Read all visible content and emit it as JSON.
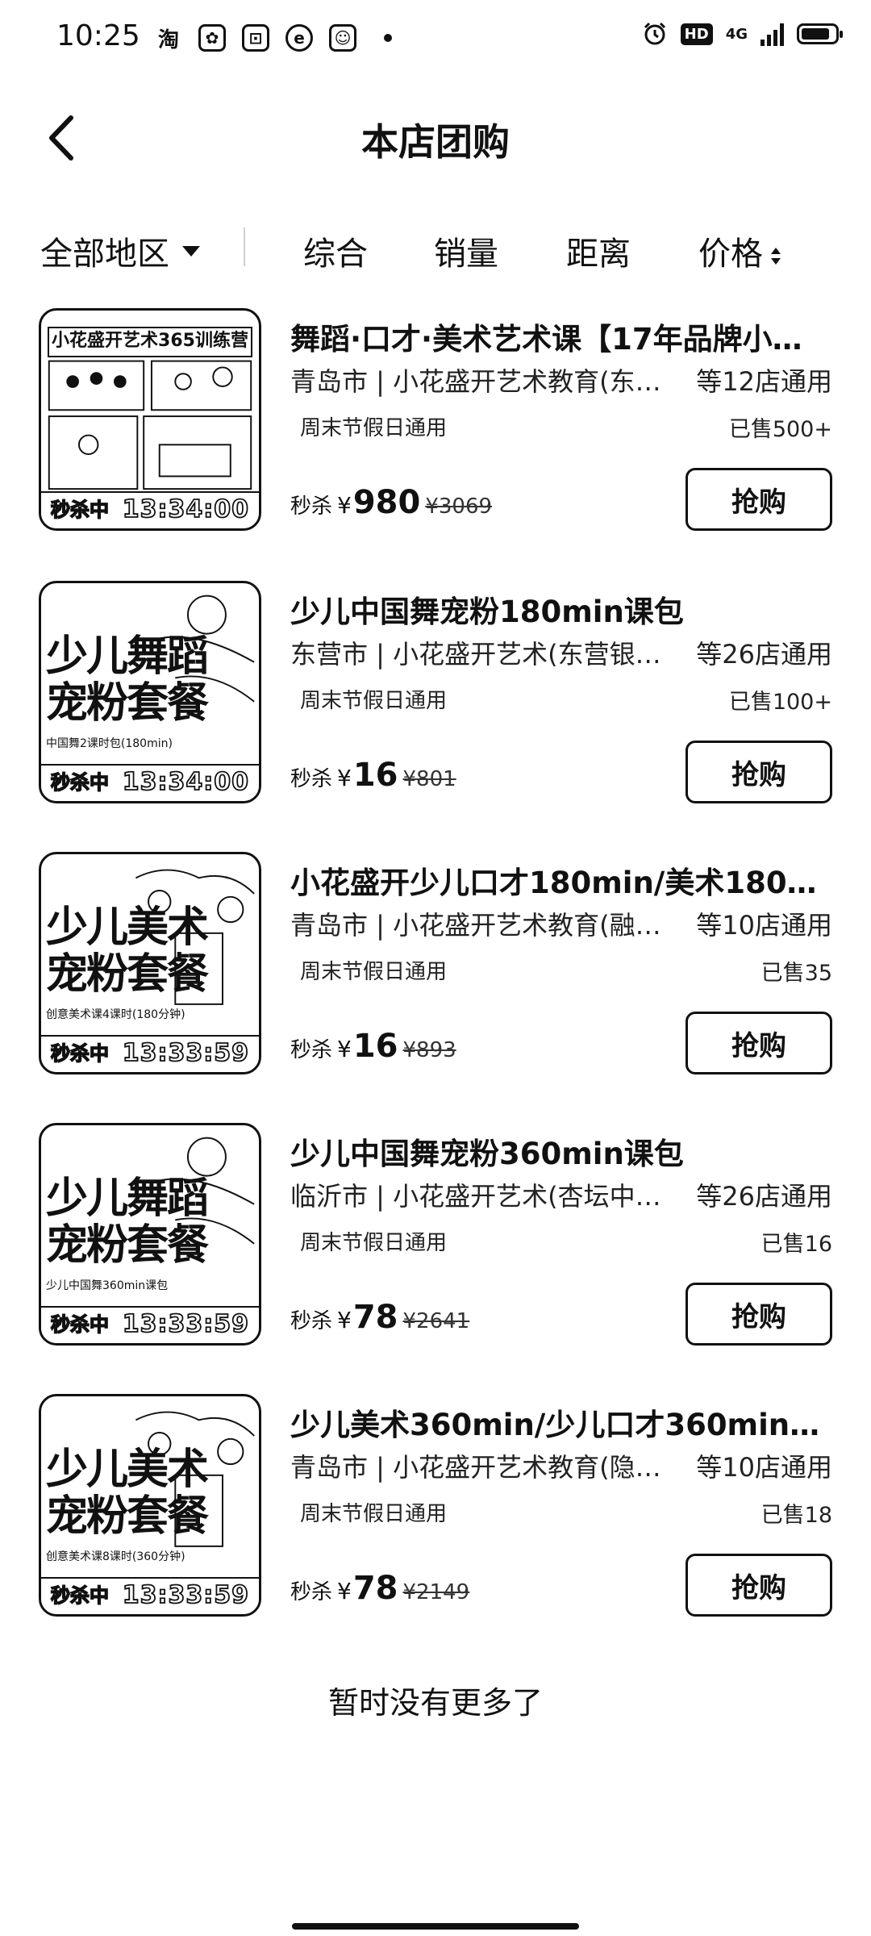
{
  "status_bar": {
    "time": "10:25",
    "left_icons": [
      "taobao-icon",
      "app-icon-1",
      "app-icon-2",
      "app-icon-3",
      "app-icon-4"
    ],
    "hd": "HD",
    "network": "4G"
  },
  "header": {
    "title": "本店团购"
  },
  "filters": {
    "region": "全部地区",
    "sort_overall": "综合",
    "sort_sales": "销量",
    "sort_distance": "距离",
    "sort_price": "价格"
  },
  "products": [
    {
      "title": "舞蹈·口才·美术艺术课【17年品牌小…",
      "location": "青岛市 | 小花盛开艺术教育(东…",
      "stores": "等12店通用",
      "tag": "周末节假日通用",
      "sold": "已售500+",
      "price_label": "秒杀",
      "currency": "¥",
      "price": "980",
      "original_price": "¥3069",
      "thumb_label": "秒杀中",
      "timer": "13:34:00",
      "thumb_banner": "小花盛开艺术365训练营",
      "thumb_headline": "",
      "thumb_caption": "",
      "buy_label": "抢购"
    },
    {
      "title": "少儿中国舞宠粉180min课包",
      "location": "东营市 | 小花盛开艺术(东营银…",
      "stores": "等26店通用",
      "tag": "周末节假日通用",
      "sold": "已售100+",
      "price_label": "秒杀",
      "currency": "¥",
      "price": "16",
      "original_price": "¥801",
      "thumb_label": "秒杀中",
      "timer": "13:34:00",
      "thumb_banner": "",
      "thumb_headline": "少儿舞蹈\n宠粉套餐",
      "thumb_caption": "中国舞2课时包(180min)",
      "buy_label": "抢购"
    },
    {
      "title": "小花盛开少儿口才180min/美术180…",
      "location": "青岛市 | 小花盛开艺术教育(融…",
      "stores": "等10店通用",
      "tag": "周末节假日通用",
      "sold": "已售35",
      "price_label": "秒杀",
      "currency": "¥",
      "price": "16",
      "original_price": "¥893",
      "thumb_label": "秒杀中",
      "timer": "13:33:59",
      "thumb_banner": "",
      "thumb_headline": "少儿美术\n宠粉套餐",
      "thumb_caption": "创意美术课4课时(180分钟)",
      "buy_label": "抢购"
    },
    {
      "title": "少儿中国舞宠粉360min课包",
      "location": "临沂市 | 小花盛开艺术(杏坛中…",
      "stores": "等26店通用",
      "tag": "周末节假日通用",
      "sold": "已售16",
      "price_label": "秒杀",
      "currency": "¥",
      "price": "78",
      "original_price": "¥2641",
      "thumb_label": "秒杀中",
      "timer": "13:33:59",
      "thumb_banner": "",
      "thumb_headline": "少儿舞蹈\n宠粉套餐",
      "thumb_caption": "少儿中国舞360min课包",
      "buy_label": "抢购"
    },
    {
      "title": "少儿美术360min/少儿口才360min…",
      "location": "青岛市 | 小花盛开艺术教育(隐…",
      "stores": "等10店通用",
      "tag": "周末节假日通用",
      "sold": "已售18",
      "price_label": "秒杀",
      "currency": "¥",
      "price": "78",
      "original_price": "¥2149",
      "thumb_label": "秒杀中",
      "timer": "13:33:59",
      "thumb_banner": "",
      "thumb_headline": "少儿美术\n宠粉套餐",
      "thumb_caption": "创意美术课8课时(360分钟)",
      "buy_label": "抢购"
    }
  ],
  "footer": {
    "no_more": "暂时没有更多了"
  }
}
